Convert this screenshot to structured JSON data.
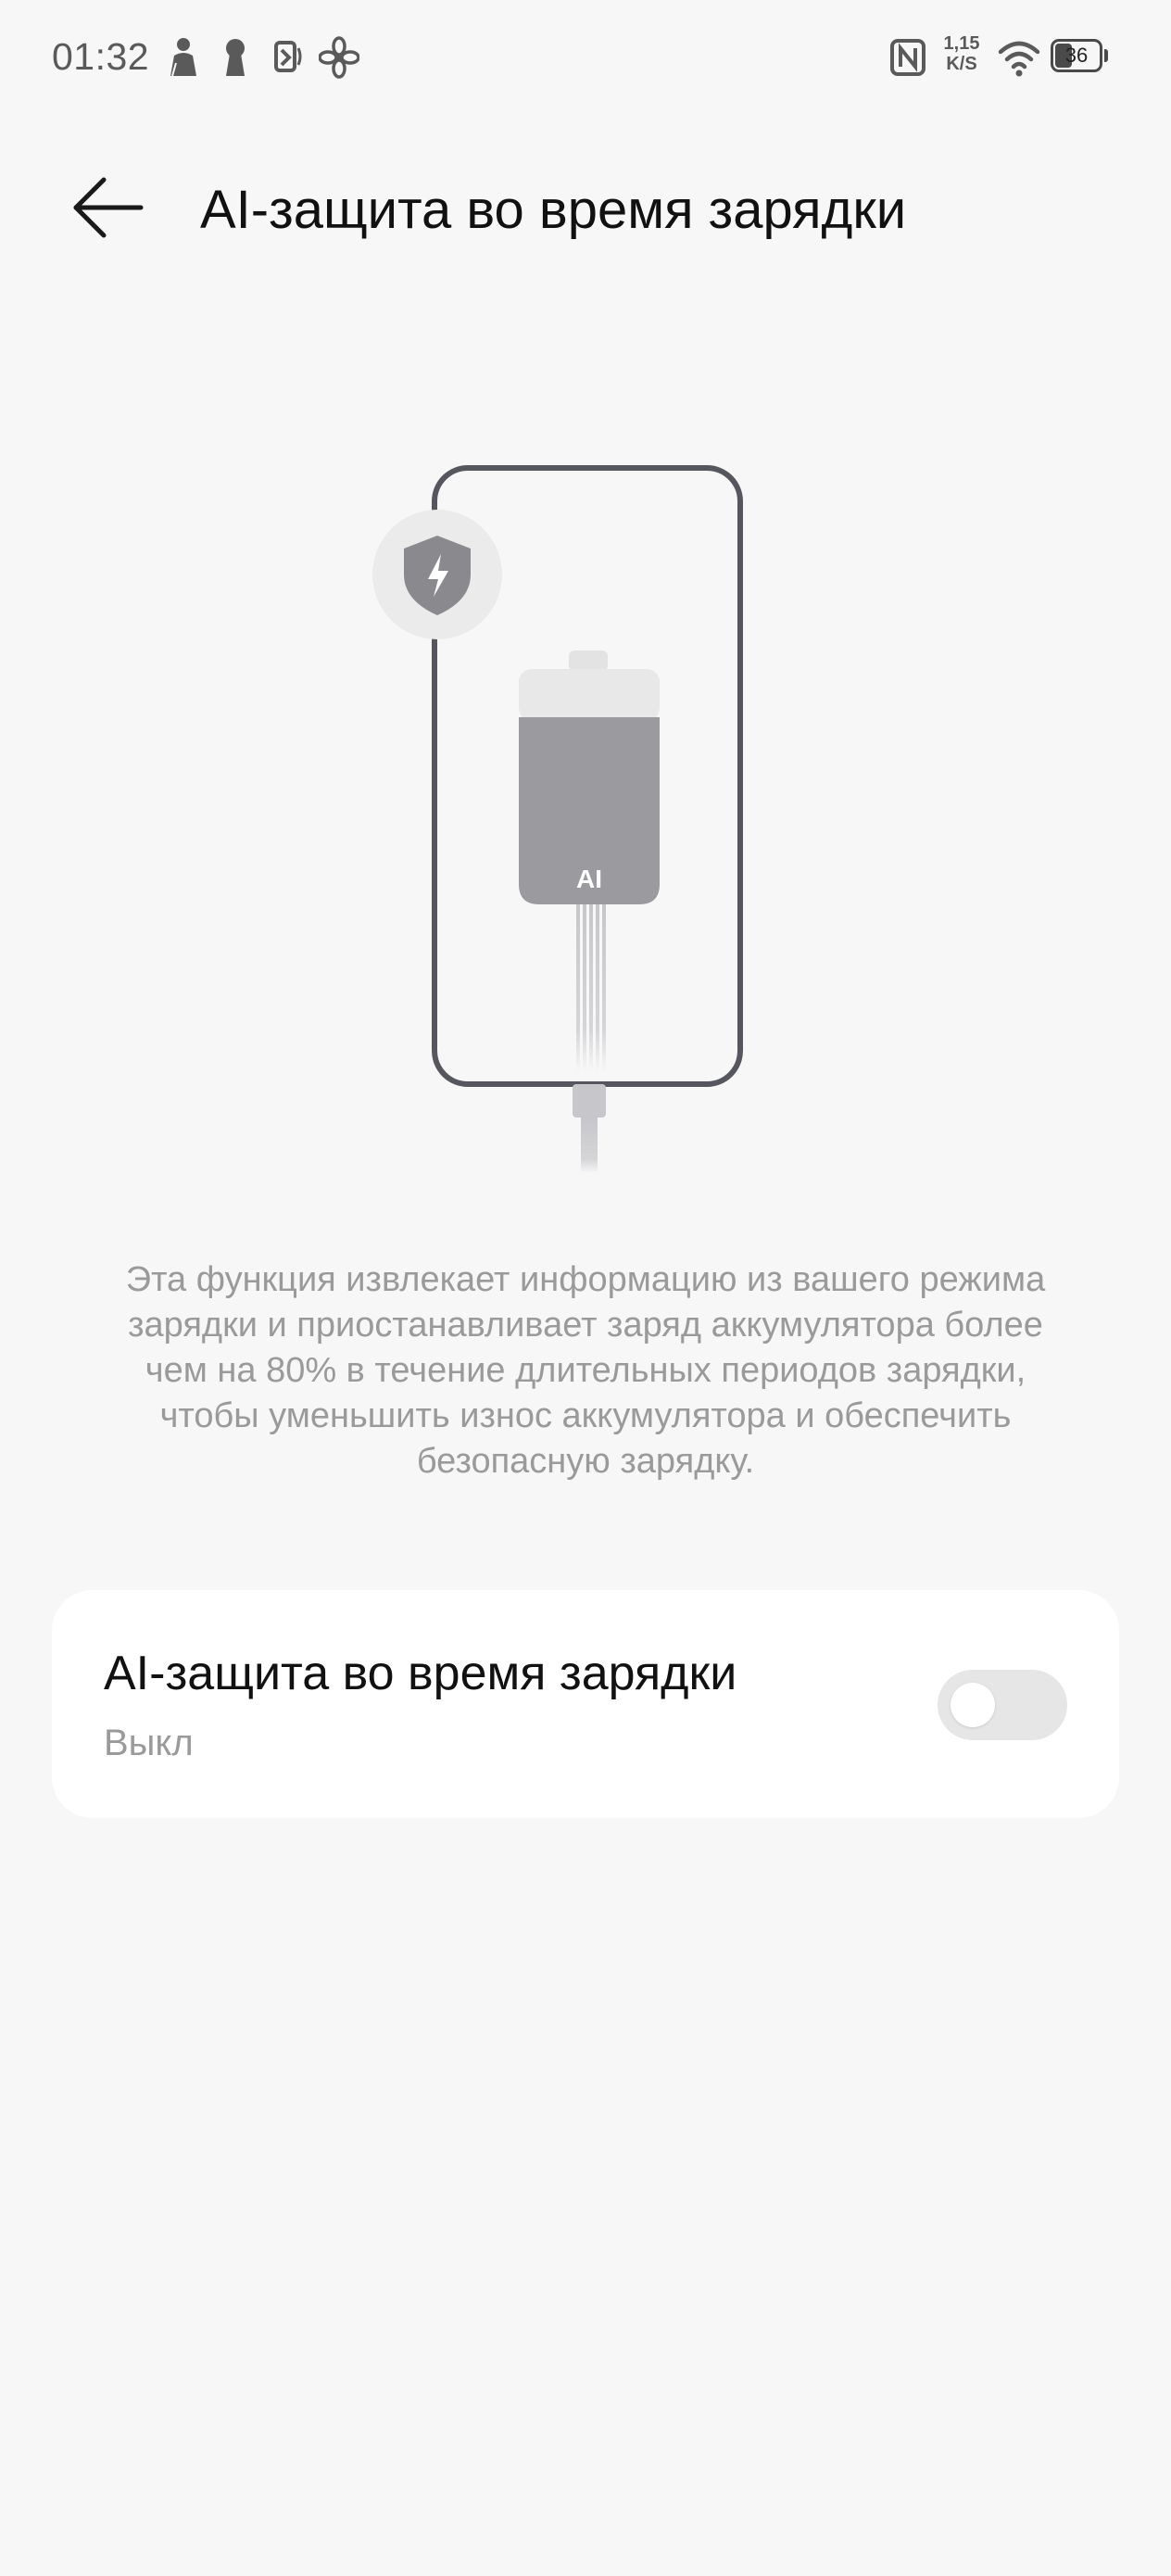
{
  "status_bar": {
    "time": "01:32",
    "notification_icons": [
      "person-silhouette-icon",
      "keyhole-icon",
      "nfc-tag-icon",
      "fan-icon"
    ],
    "nfc_icon": "nfc-icon",
    "net_speed_value": "1,15",
    "net_speed_unit": "K/S",
    "wifi_icon": "wifi-icon",
    "battery_level": "36"
  },
  "header": {
    "back_icon": "arrow-left-icon",
    "title": "AI-защита во время зарядки"
  },
  "illustration": {
    "battery_label": "AI",
    "shield_icon": "shield-lightning-icon",
    "colors": {
      "phone_outline": "#56565e",
      "battery_fill": "#9a9a9f",
      "battery_top": "#e8e8e8",
      "shield": "#8a8a8e",
      "shield_badge": "#ebebeb"
    }
  },
  "description": "Эта функция извлекает информацию из вашего режима зарядки и приостанавливает заряд аккумулятора более чем на 80% в течение длительных периодов зарядки, чтобы уменьшить износ аккумулятора и обеспечить безопасную зарядку.",
  "setting": {
    "title": "AI-защита во время зарядки",
    "status": "Выкл",
    "toggle_on": false
  }
}
